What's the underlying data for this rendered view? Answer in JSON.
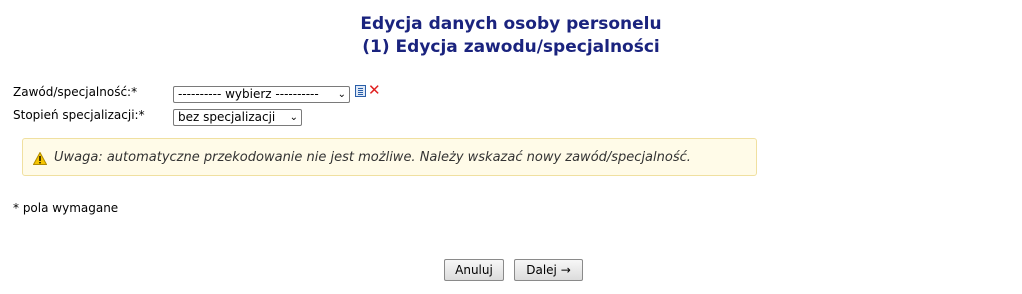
{
  "header": {
    "title": "Edycja danych osoby personelu",
    "subtitle": "(1) Edycja zawodu/specjalności"
  },
  "form": {
    "profession_label": "Zawód/specjalność:*",
    "profession_value": "---------- wybierz ----------",
    "degree_label": "Stopień specjalizacji:*",
    "degree_value": "bez specjalizacji"
  },
  "icons": {
    "list": "list-icon",
    "clear": "clear-x-icon",
    "warning": "warning-icon"
  },
  "notice": {
    "text": "Uwaga: automatyczne przekodowanie nie jest możliwe. Należy wskazać nowy zawód/specjalność."
  },
  "footer": {
    "required_note": "* pola wymagane"
  },
  "buttons": {
    "cancel": "Anuluj",
    "next": "Dalej →"
  },
  "colors": {
    "title": "#1a237e",
    "notice_bg": "#fffbe8",
    "notice_border": "#f0e0a0",
    "clear_icon": "#e02020"
  }
}
